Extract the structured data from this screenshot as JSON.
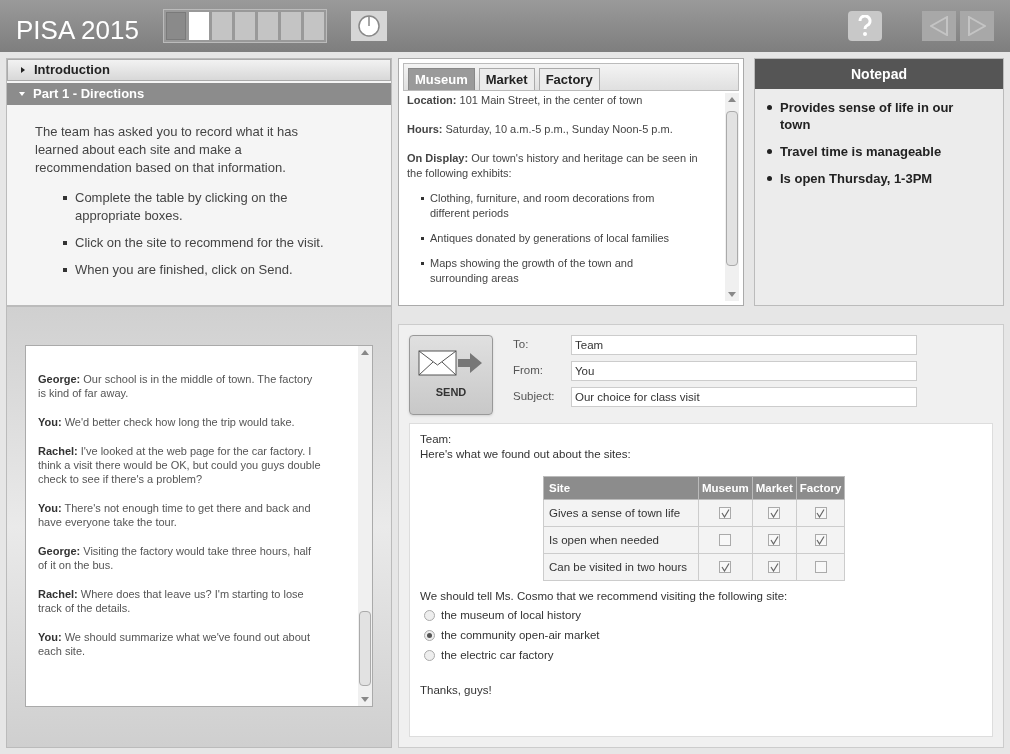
{
  "header": {
    "title": "PISA 2015",
    "progress_steps": [
      {
        "completed": true,
        "current": false
      },
      {
        "completed": false,
        "current": true
      },
      {
        "completed": false,
        "current": false
      },
      {
        "completed": false,
        "current": false
      },
      {
        "completed": false,
        "current": false
      },
      {
        "completed": false,
        "current": false
      },
      {
        "completed": false,
        "current": false
      }
    ],
    "back_disabled": true,
    "forward_disabled": true
  },
  "accordion": [
    {
      "label": "Introduction",
      "expanded": false
    },
    {
      "label": "Part 1 - Directions",
      "expanded": true
    }
  ],
  "directions": {
    "intro": "The team has asked you to record what it has learned about each site and make a recommendation based on that information.",
    "steps": [
      "Complete the table by clicking on the appropriate boxes.",
      "Click on the site to recommend for the visit.",
      "When you are finished, click on Send."
    ]
  },
  "chat": [
    {
      "speaker": "George:",
      "text": "Our school is in the middle of town. The factory is kind of far away."
    },
    {
      "speaker": "You:",
      "text": "We'd better check how long the trip would take."
    },
    {
      "speaker": "Rachel:",
      "text": "I've looked at the web page for the car factory. I think a visit there would be OK, but could you guys double check to see if there's a problem?"
    },
    {
      "speaker": "You:",
      "text": "There's not enough time to get there and back and have everyone take the tour."
    },
    {
      "speaker": "George:",
      "text": "Visiting the factory would take three hours, half of it on the bus."
    },
    {
      "speaker": "Rachel:",
      "text": "Where does that leave us? I'm starting to lose track of the details."
    },
    {
      "speaker": "You:",
      "text": "We should summarize what we've found out about each site."
    }
  ],
  "site_tabs": [
    {
      "label": "Museum",
      "selected": true
    },
    {
      "label": "Market",
      "selected": false
    },
    {
      "label": "Factory",
      "selected": false
    }
  ],
  "site_info": {
    "paragraphs": [
      "**Location:** 101 Main Street, in the center of town",
      "**Hours:** Saturday, 10 a.m.-5 p.m., Sunday Noon-5 p.m.",
      "**On Display:** Our town's history and heritage can be seen in the following exhibits:"
    ],
    "exhibits": [
      "Clothing, furniture, and room decorations from different periods",
      "Antiques donated by generations of local families",
      "Maps showing the growth of the town and surrounding areas"
    ]
  },
  "notepad": {
    "title": "Notepad",
    "items": [
      "Provides sense of life in our town",
      "Travel time is manageable",
      "Is open Thursday, 1-3PM"
    ]
  },
  "email": {
    "send_label": "SEND",
    "fields": [
      {
        "label": "To:",
        "value": "Team"
      },
      {
        "label": "From:",
        "value": "You"
      },
      {
        "label": "Subject:",
        "value": "Our choice for class visit"
      }
    ],
    "greeting": "Team:",
    "intro": "Here's what we found out about the sites:",
    "table": {
      "columns": [
        "Site",
        "Museum",
        "Market",
        "Factory"
      ],
      "rows": [
        {
          "label": "Gives a sense of town life",
          "checks": [
            {
              "checked": true
            },
            {
              "checked": true
            },
            {
              "checked": true
            }
          ]
        },
        {
          "label": "Is open when needed",
          "checks": [
            {
              "checked": false
            },
            {
              "checked": true
            },
            {
              "checked": true
            }
          ]
        },
        {
          "label": "Can be visited in two hours",
          "checks": [
            {
              "checked": true
            },
            {
              "checked": true
            },
            {
              "checked": false
            }
          ]
        }
      ]
    },
    "question": "We should tell Ms. Cosmo that we recommend visiting the following site:",
    "options": [
      {
        "label": "the museum of local history",
        "selected": false
      },
      {
        "label": "the community open-air market",
        "selected": true
      },
      {
        "label": "the electric car factory",
        "selected": false
      }
    ],
    "closing": "Thanks, guys!"
  }
}
